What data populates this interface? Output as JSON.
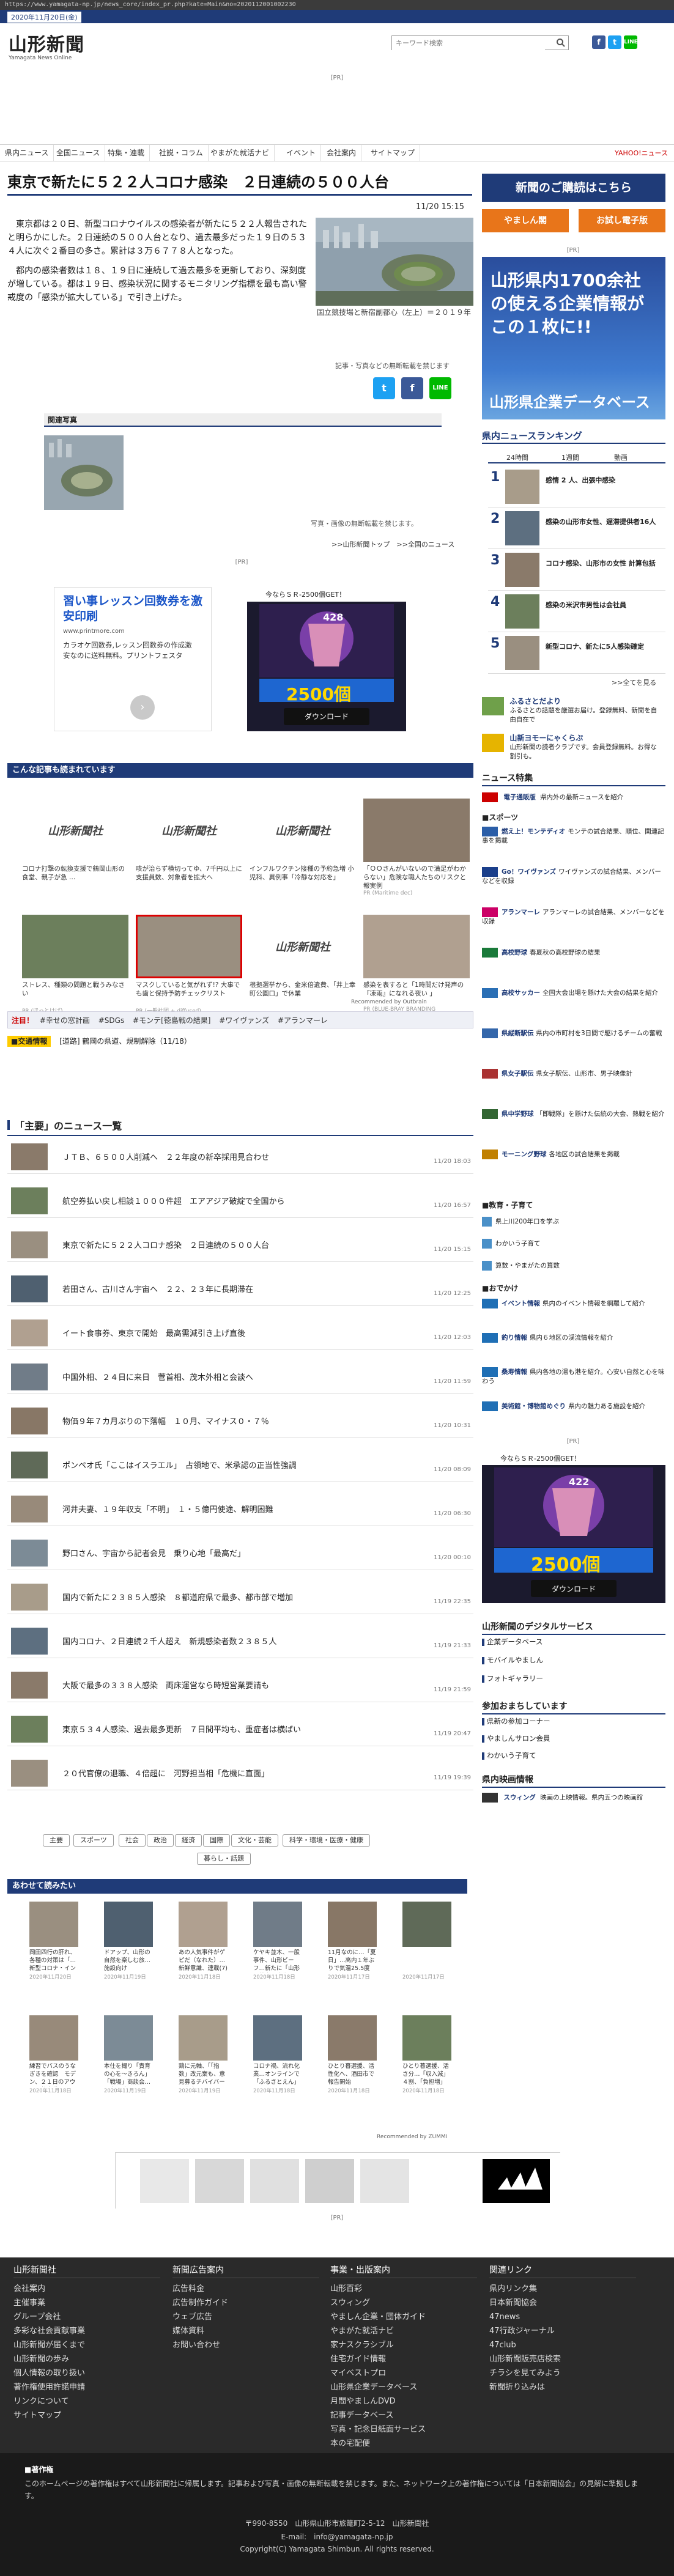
{
  "browser": {
    "url": "https://www.yamagata-np.jp/news_core/index_pr.php?kate=Main&no=2020112001002230"
  },
  "date_label": "2020年11月20日(金)",
  "site": {
    "logo": "山形新聞",
    "logo_sub": "Yamagata News Online"
  },
  "search": {
    "placeholder": "キーワード検索"
  },
  "pr": "[PR]",
  "nav": [
    "県内ニュース",
    "全国ニュース",
    "特集・連載",
    "社説・コラム",
    "やまがた就活ナビ",
    "イベント",
    "会社案内",
    "サイトマップ"
  ],
  "nav_right": "YAHOO!ニュース",
  "article": {
    "headline": "東京で新たに５２２人コロナ感染　２日連続の５００人台",
    "time": "11/20 15:15",
    "paragraphs": [
      "　東京都は２０日、新型コロナウイルスの感染者が新たに５２２人報告されたと明らかにした。２日連続の５００人台となり、過去最多だった１９日の５３４人に次ぐ２番目の多さ。累計は３万６７７８人となった。",
      "　都内の感染者数は１８、１９日に連続して過去最多を更新しており、深刻度が増している。都は１９日、感染状況に関するモニタリング指標を最も高い警戒度の「感染が拡大している」で引き上げた。"
    ],
    "photo_caption": "国立競技場と新宿副都心（左上）＝２０１９年",
    "photo_note": "記事・写真などの無断転載を禁じます",
    "related_header": "関連写真",
    "related_note": "写真・画像の無断転載を禁じます。",
    "related_links": ">>山形新聞トップ　>>全国のニュース"
  },
  "ad_left": {
    "title": "習い事レッスン回数券を激安印刷",
    "site": "www.printmore.com",
    "desc": "カラオケ回数券,レッスン回数券の作成激安なのに送料無料。プリントフェスタ"
  },
  "ad_right": {
    "top": "今ならＳＲ-2500個GET！",
    "num": "428",
    "amount": "2500個",
    "button": "ダウンロード"
  },
  "recommend": {
    "header": "こんな記事も読まれています",
    "items": [
      {
        "t": "コロナ打撃の転換支援で鶴岡山形の食堂、親子が急 …",
        "s": "",
        "logo": "山形新聞社"
      },
      {
        "t": "咳が治らず横切ってゆ、7千円以上に 支援員数、対象者を拡大へ",
        "s": "",
        "logo": "山形新聞社"
      },
      {
        "t": "インフルワクチン接種の予約急増 小児科、異例事「冷静な対応を」",
        "s": "",
        "logo": "山形新聞社"
      },
      {
        "t": "「ＯＯさんがいないので満足がわからない」危険な職人たちのリスクと報実例",
        "s": "PR (Maritime dec)",
        "logo": ""
      },
      {
        "t": "ストレス、種類の問題と戦うみなさい",
        "s": "PR (ほっとけば)",
        "logo": ""
      },
      {
        "t": "マスクしていると気がれず!? 大事でも歯と保持予防チェックリスト",
        "s": "PR (一般社団 + diffused)",
        "logo": ""
      },
      {
        "t": "根拠選挙から、金米倍遺費、「井上幸町公園口」で休業",
        "s": "",
        "logo": "山形新聞社"
      },
      {
        "t": "感染を表すると「1時間だけ発声の『凍雨』になれる夜い 」",
        "s": "PR (BLUE-BRAY BRANDING CORPORATION)",
        "logo": ""
      }
    ],
    "credit": "Recommended by Outbrain"
  },
  "tags": {
    "label": "注目！",
    "items": [
      "#幸せの窓計画",
      "#SDGs",
      "#モンテ[徳島戦の結果]",
      "#ワイヴァンズ",
      "#アランマーレ"
    ]
  },
  "traffic": {
    "label": "■交通情報",
    "text": "[道路] 鶴岡の県道、規制解除（11/18）"
  },
  "main_news": {
    "header": "「主要」のニュース一覧",
    "items": [
      {
        "t": "ＪＴＢ、６５００人削減へ　２２年度の新卒採用見合わせ",
        "d": "11/20 18:03"
      },
      {
        "t": "航空券払い戻し相談１０００件超　エアアジア破綻で全国から",
        "d": "11/20 16:57"
      },
      {
        "t": "東京で新たに５２２人コロナ感染　２日連続の５００人台",
        "d": "11/20 15:15"
      },
      {
        "t": "若田さん、古川さん宇宙へ　２２、２３年に長期滞在",
        "d": "11/20 12:25"
      },
      {
        "t": "イート食事券、東京で開始　最高需減引き上げ直後",
        "d": "11/20 12:03"
      },
      {
        "t": "中国外相、２４日に来日　菅首相、茂木外相と会談へ",
        "d": "11/20 11:59"
      },
      {
        "t": "物価９年７カ月ぶりの下落幅　１０月、マイナス０・７％",
        "d": "11/20 10:31"
      },
      {
        "t": "ポンペオ氏「ここはイスラエル」　占領地で、米承認の正当性強調",
        "d": "11/20 08:09"
      },
      {
        "t": "河井夫妻、１９年収支「不明」　１・５億円使途、解明困難",
        "d": "11/20 06:30"
      },
      {
        "t": "野口さん、宇宙から記者会見　乗り心地「最高だ」",
        "d": "11/20 00:10"
      },
      {
        "t": "国内で新たに２３８５人感染　８都道府県で最多、都市部で増加",
        "d": "11/19 22:35"
      },
      {
        "t": "国内コロナ、２日連続２千人超え　新規感染者数２３８５人",
        "d": "11/19 21:33"
      },
      {
        "t": "大阪で最多の３３８人感染　両床運営なら時短営業要請も",
        "d": "11/19 21:59"
      },
      {
        "t": "東京５３４人感染、過去最多更新　７日間平均も、重症者は横ばい",
        "d": "11/19 20:47"
      },
      {
        "t": "２０代官僚の退職、４倍超に　河野担当相「危機に直面」",
        "d": "11/19 19:39"
      }
    ]
  },
  "categories": [
    "主要",
    "スポーツ",
    "社会",
    "政治",
    "経済",
    "国際",
    "文化・芸能",
    "科学・環境・医療・健康",
    "暮らし・話題"
  ],
  "awasete": {
    "header": "あわせて読みたい",
    "items": [
      {
        "t": "岡田四行の肝れ、各種の対策は「…新型コロナ・インフル」",
        "d": "2020年11月20日"
      },
      {
        "t": "ドアップ、山形の自然を楽しむ旅… 施設向け",
        "d": "2020年11月19日"
      },
      {
        "t": "あの人気事件がゲピだ（なれた）…新鮮意識、連載(7)",
        "d": "2020年11月18日"
      },
      {
        "t": "ケヤキ並木、一般事件、山形ビーフ…新たに「山形工芸家の肖像」",
        "d": "2020年11月18日"
      },
      {
        "t": "11月なのに…「夏日」…高内１年ぶりで気温25.5度",
        "d": "2020年11月17日"
      },
      {
        "t": "",
        "d": "2020年11月17日"
      },
      {
        "t": "練習でバスのうなぎきを確認　モデン、２１日のアウェー徳島戦",
        "d": "2020年11月18日"
      },
      {
        "t": "本仕を撮り「責育の心を〜きろん」「戦場」商談会…県産の味…",
        "d": "2020年11月19日"
      },
      {
        "t": "鶏に元軸、「「指数」改元案も、意見募るチバイバーク上京",
        "d": "2020年11月19日"
      },
      {
        "t": "コロナ禍、流れ化業…オンラインで「ふるさとえん」",
        "d": "2020年11月18日"
      },
      {
        "t": "ひとり暮選援、活性化へ、酒田市で報告開始",
        "d": "2020年11月18日"
      },
      {
        "t": "ひとり暮選援、活さ分…「収入減」４割、「負担増」７割",
        "d": "2020年11月18日"
      }
    ],
    "credit": "Recommended by ZUMMI"
  },
  "sidebar": {
    "subscribe": "新聞のご購読はこちら",
    "btn1": "やましん閣",
    "btn2": "お試し電子版",
    "banner_l1": "山形県内1700余社の使える企業情報がこの１枚に!!",
    "banner_l2": "山形県企業データベース",
    "ranking_title": "県内ニュースランキング",
    "ranking_tabs": [
      "24時間",
      "1週間",
      "動画"
    ],
    "ranking": [
      {
        "n": "1",
        "t": "感情 2 人、出張中感染"
      },
      {
        "t": "感染の山形市女性、遅滞提供者16人",
        "n": "2"
      },
      {
        "t": "コロナ感染、山形市の女性 計算包括",
        "n": "3"
      },
      {
        "t": "感染の米沢市男性は会社員",
        "n": "4"
      },
      {
        "t": "新型コロナ、新たに5人感染確定",
        "n": "5"
      }
    ],
    "more": ">>全てを見る",
    "furusato": {
      "t1": "ふるさとだより",
      "d1": "ふるさとの話題を厳選お届け。登録無料、新聞を自由自在で",
      "t2": "山新ヨモーにゃくらぶ",
      "d2": "山形新聞の読者クラブです。会員登録無料。お得な割引も。"
    },
    "special_title": "ニュース特集",
    "special": [
      {
        "tag": "電子通販版",
        "t": "県内外の最新ニュースを紹介"
      }
    ],
    "sports_title": "■スポーツ",
    "sports": [
      {
        "tag": "燃え上！モンテディオ",
        "t": "モンテの試合結果、順位、関連記事を掲載"
      },
      {
        "tag": "Go！ワイヴァンズ",
        "t": "ワイヴァンズの試合結果、メンバーなどを収録"
      },
      {
        "tag": "アランマーレ",
        "t": "アランマーレの試合結果、メンバーなどを収録"
      },
      {
        "tag": "高校野球",
        "t": "春夏秋の高校野球の結果"
      },
      {
        "tag": "高校サッカー",
        "t": "全国大会出場を懸けた大会の結果を紹介"
      },
      {
        "tag": "県縦断駅伝",
        "t": "県内の市町村を3日間で駆けるチームの奮戦"
      },
      {
        "tag": "県女子駅伝",
        "t": "県女子駅伝、山形市、男子映像計"
      },
      {
        "tag": "県中学野球",
        "t": "「即戦隊」を懸けた伝統の大会、熱戦を紹介"
      },
      {
        "tag": "モーニング野球",
        "t": "各地区の試合結果を掲載"
      }
    ],
    "edu_title": "■教育・子育て",
    "edu": [
      "県上川200年口を学ぶ",
      "わかいう子育て",
      "算数・やまがたの算数"
    ],
    "odekake_title": "■おでかけ",
    "odekake": [
      {
        "tag": "イベント情報",
        "t": "県内のイベント情報を網羅して紹介"
      },
      {
        "tag": "釣り情報",
        "t": "県内６地区の渓流情報を紹介"
      },
      {
        "tag": "桑寿情報",
        "t": "県内各地の湯も港を紹介。心安い自然と心を味わう"
      },
      {
        "tag": "美術館・博物館めぐり",
        "t": "県内の魅力ある施設を紹介"
      }
    ],
    "ad_top": "今ならＳＲ-2500個GET！",
    "ad_num": "422",
    "ad_amount": "2500個",
    "ad_button": "ダウンロード",
    "digital_title": "山形新聞のデジタルサービス",
    "digital": [
      "企業データベース",
      "モバイルやましん",
      "フォトギャラリー"
    ],
    "event_title": "参加おまちしています",
    "event": [
      "県新の参加コーナー",
      "やましんサロン会員",
      "わかいう子育て"
    ],
    "movie_title": "県内映画情報",
    "movie": {
      "tag": "スウィング",
      "t": "映画の上映情報。県内五つの映画館"
    }
  },
  "footer": {
    "cols": [
      {
        "h": "山形新聞社",
        "items": [
          "会社案内",
          "主催事業",
          "グループ会社",
          "多彩な社会貢献事業",
          "山形新聞が届くまで",
          "山形新聞の歩み",
          "個人情報の取り扱い",
          "著作権使用許諾申請",
          "リンクについて",
          "サイトマップ"
        ]
      },
      {
        "h": "新聞広告案内",
        "items": [
          "広告料金",
          "広告制作ガイド",
          "ウェブ広告",
          "媒体資料",
          "お問い合わせ"
        ]
      },
      {
        "h": "事業・出版案内",
        "items": [
          "山形百彩",
          "スウィング",
          "やましん企業・団体ガイド",
          "やまがた就活ナビ",
          "家ナスクラシブル",
          "住宅ガイド情報",
          "マイベストプロ",
          "山形県企業データベース",
          "月間やましんDVD",
          "記事データベース",
          "写真・記念日紙面サービス",
          "本の宅配便"
        ]
      },
      {
        "h": "関連リンク",
        "items": [
          "県内リンク集",
          "日本新聞協会",
          "47news",
          "47行政ジャーナル",
          "47club",
          "山形新聞販売店検索",
          "チラシを見てみよう",
          "新聞折り込みは"
        ]
      }
    ],
    "copy_title": "■著作権",
    "copy_text": "このホームページの著作権はすべて山形新聞社に帰属します。記事および写真・画像の無断転載を禁じます。また、ネットワーク上の著作権については「日本新聞協会」の見解に準拠します。",
    "address": "〒990-8550　山形県山形市旅篭町2-5-12　山形新聞社",
    "email": "E-mail:　info@yamagata-np.jp",
    "copyright": "Copyright(C) Yamagata Shimbun. All rights reserved."
  },
  "colors": {
    "brand": "#1f3b78",
    "accent": "#e8751a"
  }
}
